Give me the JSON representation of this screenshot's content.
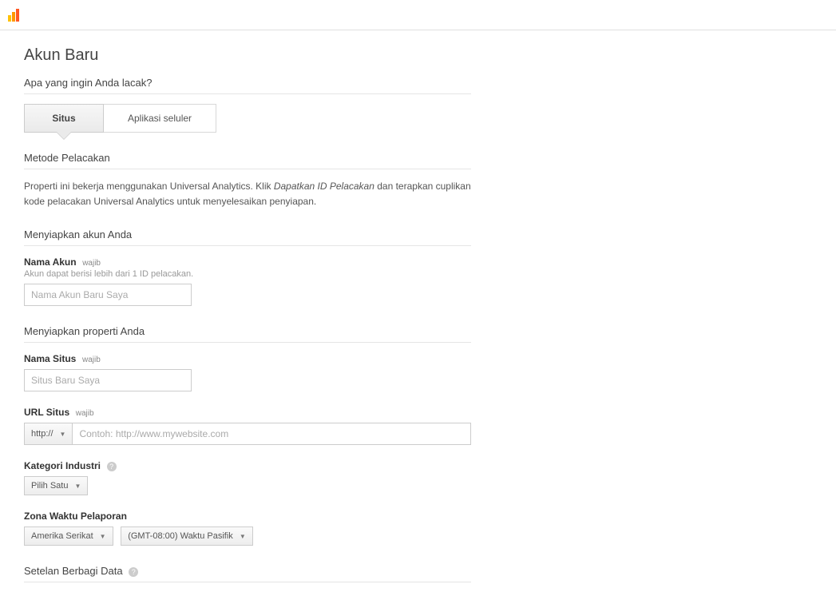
{
  "page": {
    "title": "Akun Baru"
  },
  "track_question": "Apa yang ingin Anda lacak?",
  "tabs": {
    "website": "Situs",
    "mobile": "Aplikasi seluler"
  },
  "tracking": {
    "heading": "Metode Pelacakan",
    "desc_prefix": "Properti ini bekerja menggunakan Universal Analytics. Klik ",
    "desc_em": "Dapatkan ID Pelacakan",
    "desc_suffix": " dan terapkan cuplikan kode pelacakan Universal Analytics untuk menyelesaikan penyiapan."
  },
  "account_setup": {
    "heading": "Menyiapkan akun Anda",
    "name_label": "Nama Akun",
    "name_required": "wajib",
    "name_hint": "Akun dapat berisi lebih dari 1 ID pelacakan.",
    "name_placeholder": "Nama Akun Baru Saya"
  },
  "property_setup": {
    "heading": "Menyiapkan properti Anda",
    "site_name_label": "Nama Situs",
    "site_name_required": "wajib",
    "site_name_placeholder": "Situs Baru Saya",
    "url_label": "URL Situs",
    "url_required": "wajib",
    "url_protocol": "http://",
    "url_placeholder": "Contoh: http://www.mywebsite.com",
    "industry_label": "Kategori Industri",
    "industry_value": "Pilih Satu",
    "timezone_label": "Zona Waktu Pelaporan",
    "timezone_country": "Amerika Serikat",
    "timezone_value": "(GMT-08:00) Waktu Pasifik"
  },
  "data_sharing": {
    "heading": "Setelan Berbagi Data"
  }
}
